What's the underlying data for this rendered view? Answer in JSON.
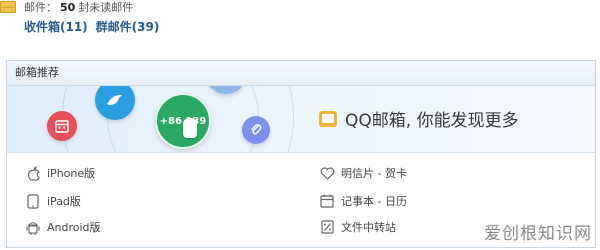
{
  "summary": {
    "prefix": "邮件：",
    "count": "50",
    "suffix": "封未读邮件"
  },
  "folders": [
    {
      "label": "收件箱(11)"
    },
    {
      "label": "群邮件(39)"
    }
  ],
  "panel": {
    "title": "邮箱推荐",
    "promo_text": "QQ邮箱, 你能发现更多",
    "phone_bubble_text": "+86 139",
    "links": [
      {
        "label": "iPhone版",
        "icon": "apple-icon"
      },
      {
        "label": "iPad版",
        "icon": "tablet-icon"
      },
      {
        "label": "Android版",
        "icon": "android-icon"
      },
      {
        "label": "明信片 - 贺卡",
        "icon": "heart-icon"
      },
      {
        "label": "记事本 - 日历",
        "icon": "calendar-icon"
      },
      {
        "label": "文件中转站",
        "icon": "file-transfer-icon"
      }
    ]
  },
  "watermark": "爱创根知识网",
  "colors": {
    "link_blue": "#2a5d8f",
    "green_bubble": "#2aa864",
    "blue_bubble": "#2a9ee0",
    "red_bubble": "#e5505a",
    "purple_bubble": "#7d8ef0"
  }
}
